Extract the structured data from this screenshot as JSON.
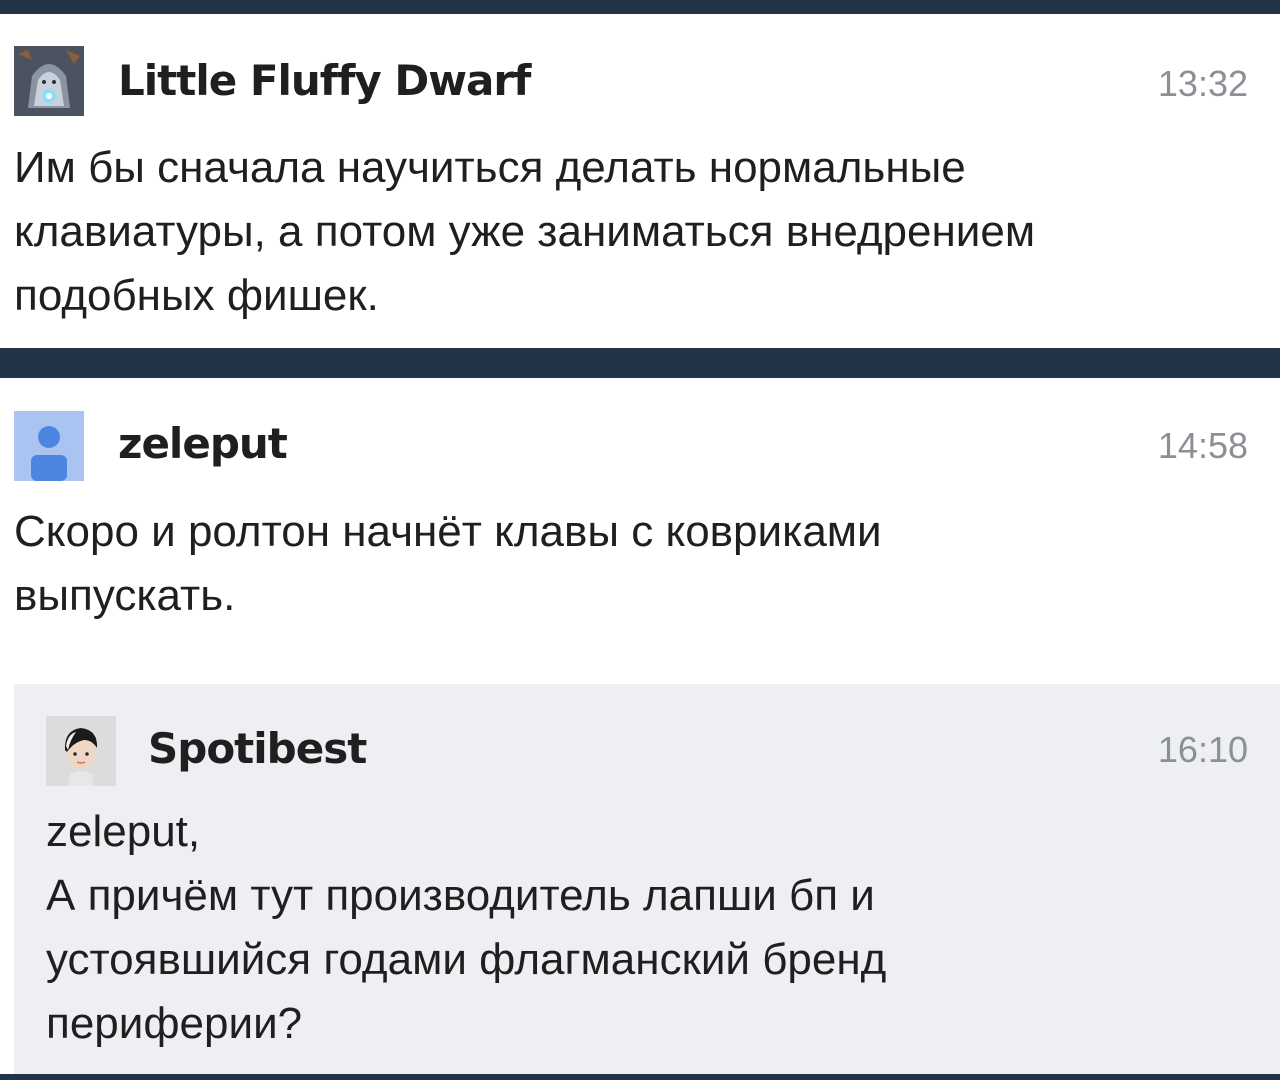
{
  "comments": [
    {
      "author": "Little Fluffy Dwarf",
      "time": "13:32",
      "text": "Им бы сначала научиться делать нормальные\nклавиатуры, а потом уже заниматься внедрением\nподобных фишек.",
      "avatar": "dwarf-avatar"
    },
    {
      "author": "zeleput",
      "time": "14:58",
      "text": "Скоро и ролтон начнёт клавы с ковриками\nвыпускать.",
      "avatar": "default-user-avatar"
    },
    {
      "author": "Spotibest",
      "time": "16:10",
      "text": "zeleput,\nА причём тут производитель лапши бп и\nустоявшийся годами флагманский бренд\nпериферии?",
      "avatar": "boy-avatar"
    }
  ],
  "colors": {
    "divider": "#243447",
    "reply_background": "#eeeff2",
    "time": "#8c8f96",
    "text": "#1f1f1f",
    "default_avatar_bg": "#a9c4f0",
    "default_avatar_fg": "#4d86e0"
  }
}
